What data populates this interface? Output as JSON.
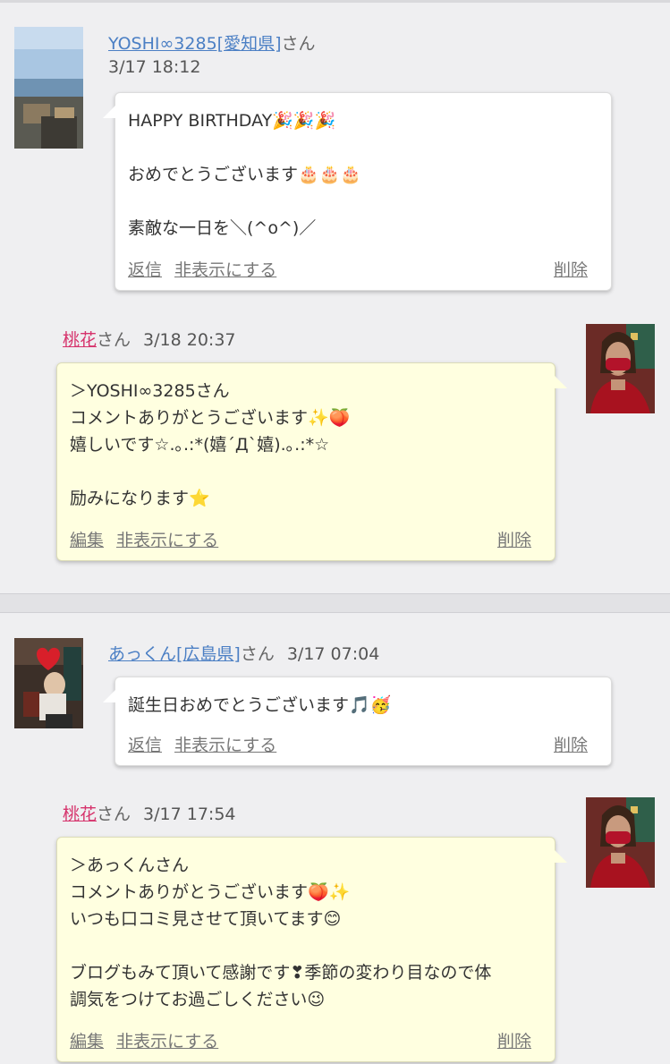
{
  "comments": [
    {
      "author": "YOSHI∞3285[愛知県]",
      "suffix": "さん",
      "time": "3/17 18:12",
      "lines": [
        "HAPPY BIRTHDAY🎉🎉🎉",
        "",
        "おめでとうございます🎂🎂🎂",
        "",
        "素敵な一日を＼(^o^)／"
      ],
      "actions": [
        "返信",
        "非表示にする"
      ],
      "delete": "削除",
      "reply": {
        "author": "桃花",
        "suffix": "さん",
        "time": "3/18 20:37",
        "lines": [
          "＞YOSHI∞3285さん",
          "コメントありがとうございます✨🍑",
          "嬉しいです☆.｡.:*(嬉´Д`嬉).｡.:*☆",
          "",
          "励みになります⭐"
        ],
        "actions": [
          "編集",
          "非表示にする"
        ],
        "delete": "削除"
      }
    },
    {
      "author": "あっくん[広島県]",
      "suffix": "さん",
      "time": "3/17 07:04",
      "lines": [
        "誕生日おめでとうございます🎵🥳"
      ],
      "actions": [
        "返信",
        "非表示にする"
      ],
      "delete": "削除",
      "reply": {
        "author": "桃花",
        "suffix": "さん",
        "time": "3/17 17:54",
        "lines": [
          "＞あっくんさん",
          "コメントありがとうございます🍑✨",
          "いつも口コミ見させて頂いてます😊",
          "",
          "ブログもみて頂いて感謝です❣季節の変わり目なので体",
          "調気をつけてお過ごしください😉"
        ],
        "actions": [
          "編集",
          "非表示にする"
        ],
        "delete": "削除"
      }
    }
  ]
}
